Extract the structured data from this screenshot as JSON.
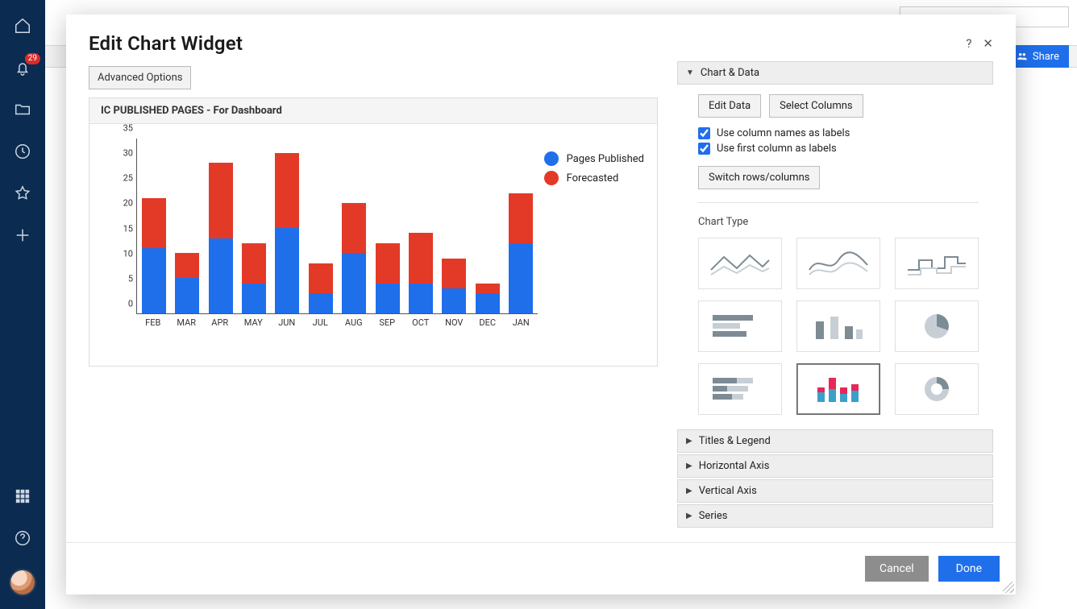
{
  "nav": {
    "badge_count": "29",
    "badge_on": "notifications"
  },
  "topbar": {
    "share_label": "Share"
  },
  "modal": {
    "title": "Edit Chart Widget",
    "advanced_options": "Advanced Options",
    "help_glyph": "?",
    "close_glyph": "✕"
  },
  "chart": {
    "title": "IC PUBLISHED PAGES - For Dashboard",
    "legend": {
      "series1": "Pages Published",
      "series2": "Forecasted",
      "color1": "#1f6feb",
      "color2": "#e33a28"
    }
  },
  "chart_data": {
    "type": "bar",
    "stacked": true,
    "categories": [
      "FEB",
      "MAR",
      "APR",
      "MAY",
      "JUN",
      "JUL",
      "AUG",
      "SEP",
      "OCT",
      "NOV",
      "DEC",
      "JAN"
    ],
    "series": [
      {
        "name": "Pages Published",
        "color": "#1f6feb",
        "values": [
          13,
          7,
          15,
          6,
          17,
          4,
          12,
          6,
          6,
          5,
          4,
          14
        ]
      },
      {
        "name": "Forecasted",
        "color": "#e33a28",
        "values": [
          10,
          5,
          15,
          8,
          15,
          6,
          10,
          8,
          10,
          6,
          2,
          10
        ]
      }
    ],
    "totals": [
      23,
      12,
      30,
      14,
      32,
      10,
      22,
      14,
      16,
      11,
      6,
      24
    ],
    "title": "IC PUBLISHED PAGES - For Dashboard",
    "xlabel": "",
    "ylabel": "",
    "ylim": [
      0,
      35
    ],
    "yticks": [
      0,
      5,
      10,
      15,
      20,
      25,
      30,
      35
    ]
  },
  "right": {
    "section_chart_data": "Chart & Data",
    "edit_data": "Edit Data",
    "select_columns": "Select Columns",
    "use_column_names": "Use column names as labels",
    "use_first_column": "Use first column as labels",
    "switch_rows": "Switch rows/columns",
    "chart_type_label": "Chart Type",
    "section_titles_legend": "Titles & Legend",
    "section_horizontal_axis": "Horizontal Axis",
    "section_vertical_axis": "Vertical Axis",
    "section_series": "Series",
    "chart_types": [
      "line",
      "spline",
      "step-line",
      "bar-horizontal",
      "bar-vertical",
      "pie",
      "stacked-bar-horizontal",
      "stacked-bar-vertical",
      "donut"
    ],
    "selected_chart_type_index": 7
  },
  "footer": {
    "cancel": "Cancel",
    "done": "Done"
  }
}
